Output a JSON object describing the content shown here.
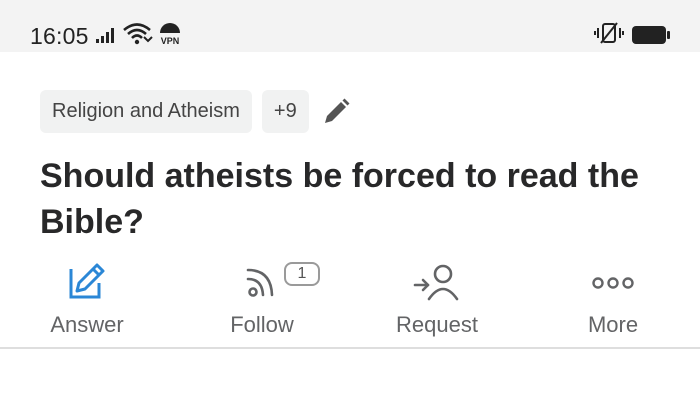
{
  "status_bar": {
    "time": "16:05",
    "icons": [
      "signal-icon",
      "wifi-icon",
      "vpn-icon",
      "vibrate-icon",
      "battery-icon"
    ],
    "vpn_label": "VPN"
  },
  "topics": {
    "primary": "Religion and Atheism",
    "more_count": "+9",
    "edit_icon": "pencil-icon"
  },
  "question": {
    "title": "Should atheists be forced to read the Bible?"
  },
  "actions": {
    "answer_label": "Answer",
    "follow_label": "Follow",
    "follow_count": "1",
    "request_label": "Request",
    "more_label": "More"
  },
  "colors": {
    "answer_accent": "#2b87d6",
    "text_primary": "#282829",
    "text_secondary": "#636466",
    "chip_bg": "#f1f2f2",
    "status_bg": "#f3f3f3"
  }
}
